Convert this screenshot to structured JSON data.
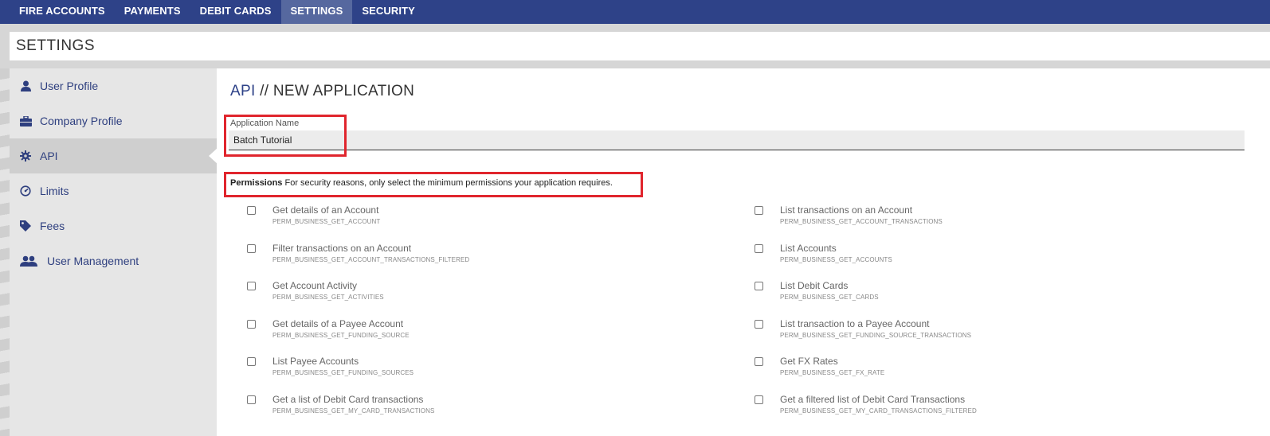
{
  "topnav": {
    "items": [
      "FIRE ACCOUNTS",
      "PAYMENTS",
      "DEBIT CARDS",
      "SETTINGS",
      "SECURITY"
    ],
    "active": "SETTINGS"
  },
  "settings_title": "SETTINGS",
  "sidebar": {
    "items": [
      {
        "label": "User Profile",
        "icon": "user-icon"
      },
      {
        "label": "Company Profile",
        "icon": "briefcase-icon"
      },
      {
        "label": "API",
        "icon": "gear-icon"
      },
      {
        "label": "Limits",
        "icon": "gauge-icon"
      },
      {
        "label": "Fees",
        "icon": "tag-icon"
      },
      {
        "label": "User Management",
        "icon": "users-icon"
      }
    ],
    "active": "API"
  },
  "main": {
    "heading_api": "API",
    "heading_rest": "// NEW APPLICATION",
    "app_name_label": "Application Name",
    "app_name_value": "Batch Tutorial",
    "permissions_label": "Permissions",
    "permissions_note": "For security reasons, only select the minimum permissions your application requires.",
    "permissions": [
      {
        "title": "Get details of an Account",
        "code": "PERM_BUSINESS_GET_ACCOUNT",
        "checked": false
      },
      {
        "title": "List transactions on an Account",
        "code": "PERM_BUSINESS_GET_ACCOUNT_TRANSACTIONS",
        "checked": false
      },
      {
        "title": "Filter transactions on an Account",
        "code": "PERM_BUSINESS_GET_ACCOUNT_TRANSACTIONS_FILTERED",
        "checked": false
      },
      {
        "title": "List Accounts",
        "code": "PERM_BUSINESS_GET_ACCOUNTS",
        "checked": false
      },
      {
        "title": "Get Account Activity",
        "code": "PERM_BUSINESS_GET_ACTIVITIES",
        "checked": false
      },
      {
        "title": "List Debit Cards",
        "code": "PERM_BUSINESS_GET_CARDS",
        "checked": false
      },
      {
        "title": "Get details of a Payee Account",
        "code": "PERM_BUSINESS_GET_FUNDING_SOURCE",
        "checked": false
      },
      {
        "title": "List transaction to a Payee Account",
        "code": "PERM_BUSINESS_GET_FUNDING_SOURCE_TRANSACTIONS",
        "checked": false
      },
      {
        "title": "List Payee Accounts",
        "code": "PERM_BUSINESS_GET_FUNDING_SOURCES",
        "checked": false
      },
      {
        "title": "Get FX Rates",
        "code": "PERM_BUSINESS_GET_FX_RATE",
        "checked": false
      },
      {
        "title": "Get a list of Debit Card transactions",
        "code": "PERM_BUSINESS_GET_MY_CARD_TRANSACTIONS",
        "checked": false
      },
      {
        "title": "Get a filtered list of Debit Card Transactions",
        "code": "PERM_BUSINESS_GET_MY_CARD_TRANSACTIONS_FILTERED",
        "checked": false
      }
    ]
  },
  "colors": {
    "nav_bg": "#2e4288",
    "nav_active": "#56689f",
    "highlight_red": "#e0252d",
    "link_blue": "#2e3f7f"
  }
}
